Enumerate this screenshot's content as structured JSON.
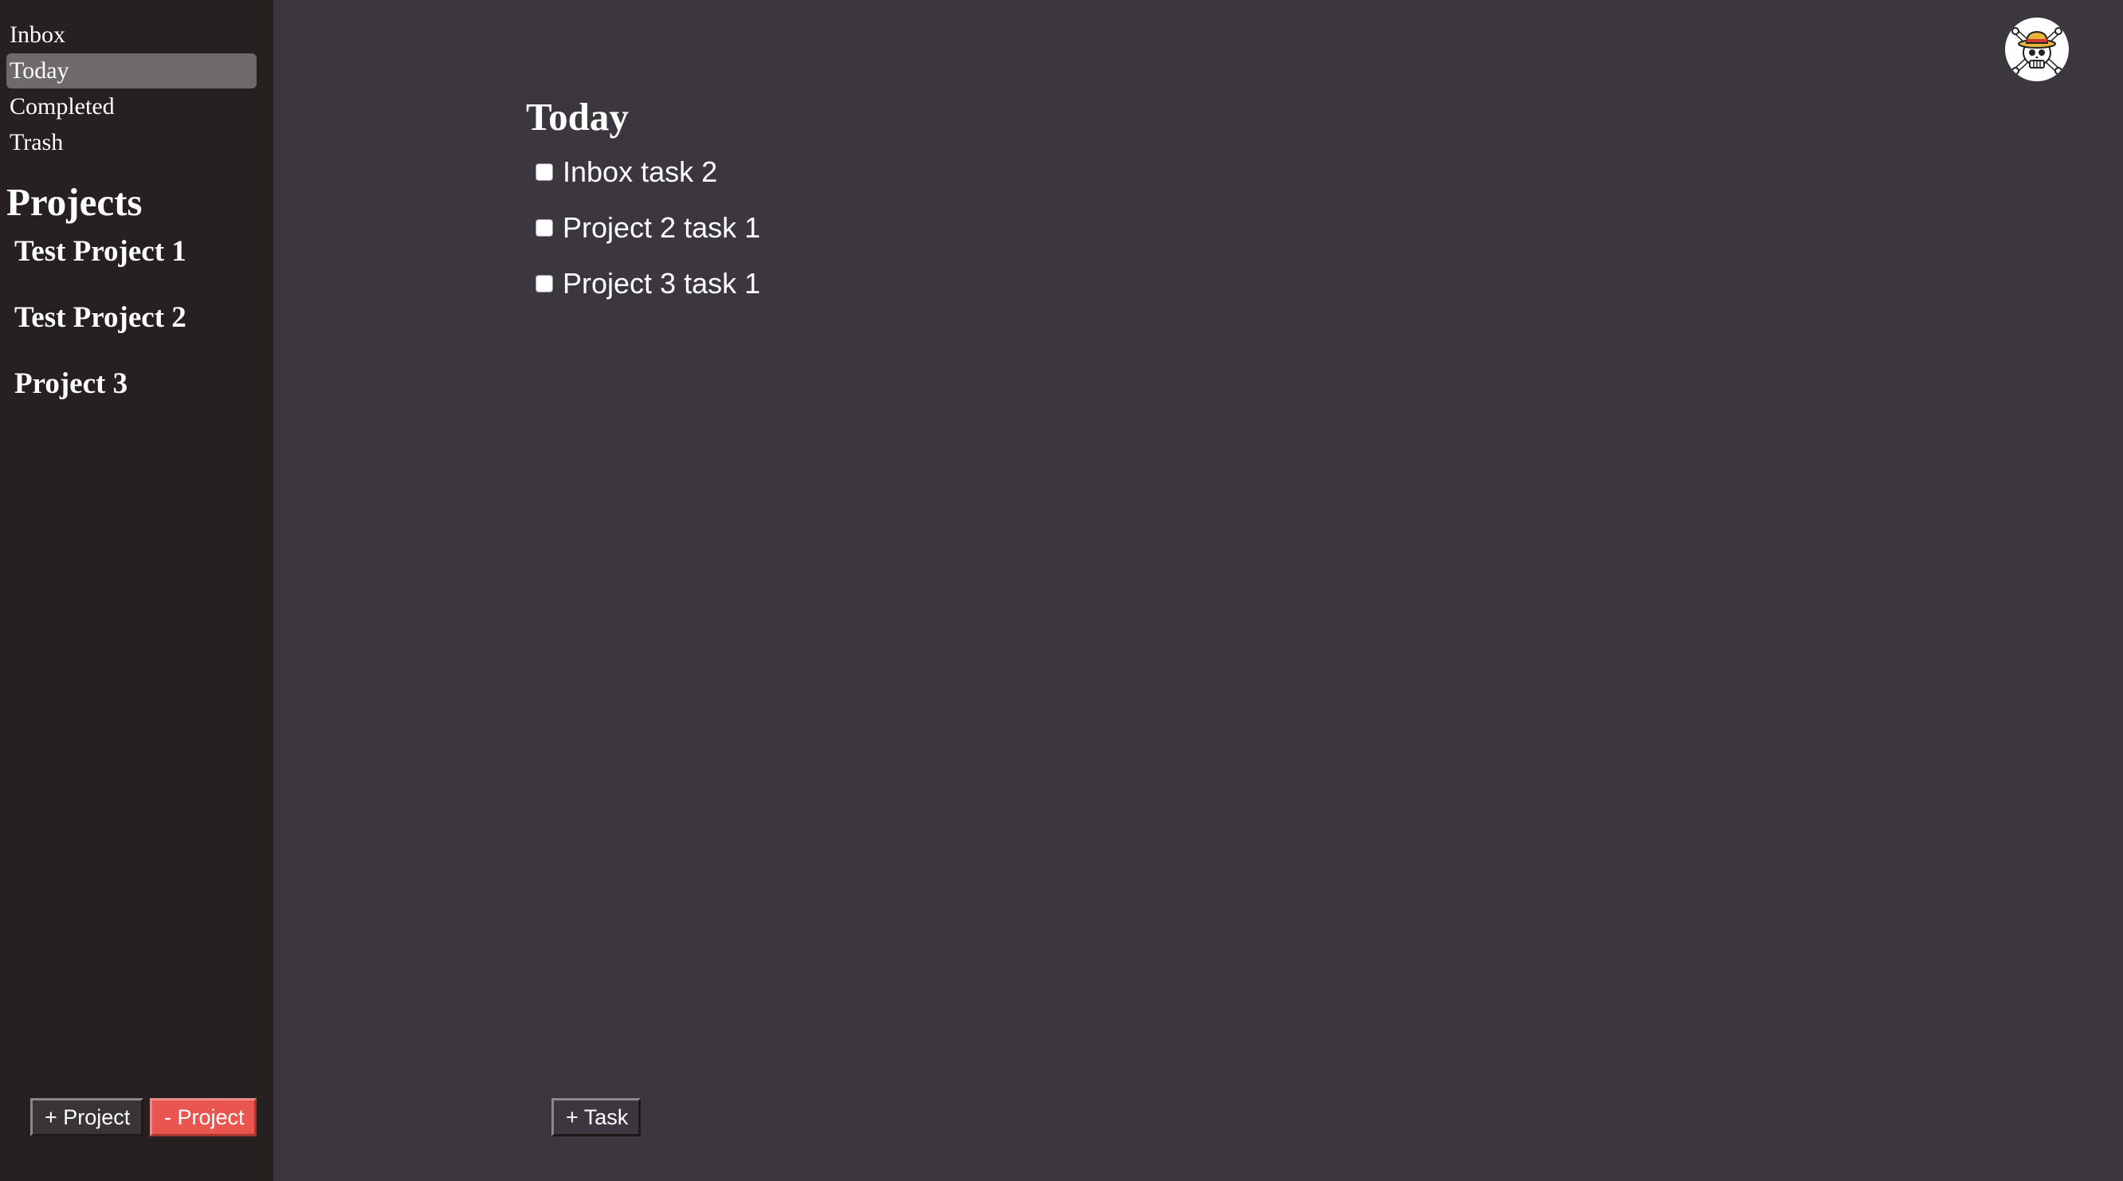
{
  "sidebar": {
    "nav_items": [
      {
        "label": "Inbox",
        "active": false
      },
      {
        "label": "Today",
        "active": true
      },
      {
        "label": "Completed",
        "active": false
      },
      {
        "label": "Trash",
        "active": false
      }
    ],
    "projects_heading": "Projects",
    "projects": [
      {
        "label": "Test Project 1"
      },
      {
        "label": "Test Project 2"
      },
      {
        "label": "Project 3"
      }
    ],
    "add_project_label": "+ Project",
    "remove_project_label": "- Project"
  },
  "main": {
    "title": "Today",
    "tasks": [
      {
        "label": "Inbox task 2",
        "checked": false
      },
      {
        "label": "Project 2 task 1",
        "checked": false
      },
      {
        "label": "Project 3 task 1",
        "checked": false
      }
    ],
    "add_task_label": "+ Task"
  },
  "avatar": {
    "icon": "straw-hat-skull-icon"
  },
  "colors": {
    "sidebar_bg": "#262020",
    "main_bg": "#3c363e",
    "active_item_bg": "#6e6a6c",
    "danger": "#e8564f",
    "text": "#ffffff"
  }
}
